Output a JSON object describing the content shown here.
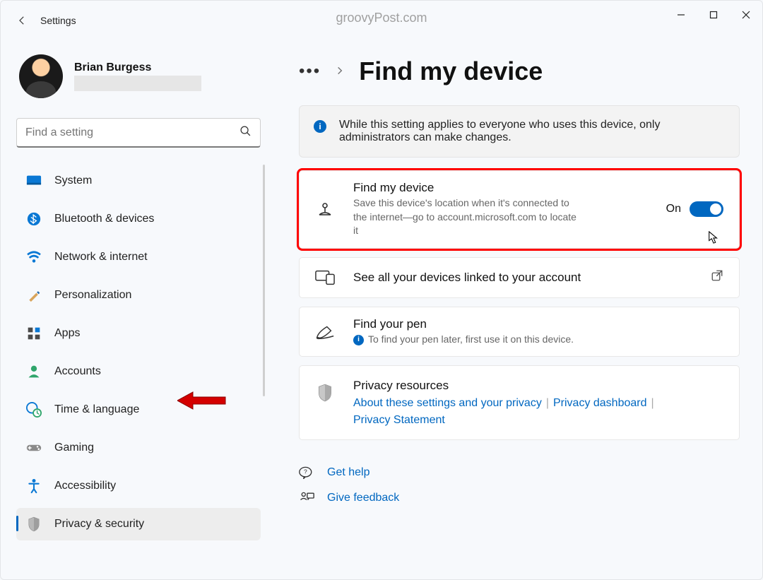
{
  "app": {
    "title": "Settings"
  },
  "watermark": "groovyPost.com",
  "user": {
    "name": "Brian Burgess"
  },
  "search": {
    "placeholder": "Find a setting"
  },
  "nav": {
    "items": [
      {
        "label": "System"
      },
      {
        "label": "Bluetooth & devices"
      },
      {
        "label": "Network & internet"
      },
      {
        "label": "Personalization"
      },
      {
        "label": "Apps"
      },
      {
        "label": "Accounts"
      },
      {
        "label": "Time & language"
      },
      {
        "label": "Gaming"
      },
      {
        "label": "Accessibility"
      },
      {
        "label": "Privacy & security"
      }
    ]
  },
  "breadcrumb": {
    "title": "Find my device"
  },
  "banner": {
    "text": "While this setting applies to everyone who uses this device, only administrators can make changes."
  },
  "card_find": {
    "title": "Find my device",
    "sub": "Save this device's location when it's connected to the internet—go to account.microsoft.com to locate it",
    "state_label": "On"
  },
  "card_devices": {
    "title": "See all your devices linked to your account"
  },
  "card_pen": {
    "title": "Find your pen",
    "sub": "To find your pen later, first use it on this device."
  },
  "card_privacy": {
    "title": "Privacy resources",
    "link1": "About these settings and your privacy",
    "link2": "Privacy dashboard",
    "link3": "Privacy Statement"
  },
  "help": {
    "get_help": "Get help",
    "feedback": "Give feedback"
  }
}
